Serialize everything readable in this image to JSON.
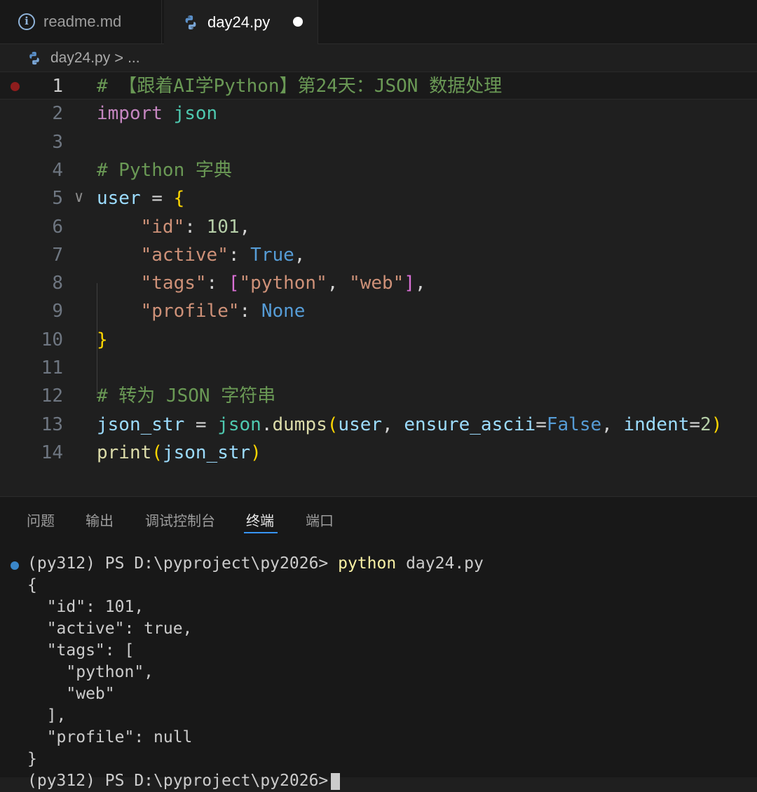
{
  "tabs": [
    {
      "label": "readme.md",
      "icon": "info-icon",
      "active": false
    },
    {
      "label": "day24.py",
      "icon": "python-icon",
      "active": true,
      "dirty": true
    }
  ],
  "breadcrumb": {
    "file": "day24.py",
    "separator": ">",
    "more": "..."
  },
  "editor": {
    "lines": [
      {
        "n": "1",
        "code": "# 【跟着AI学Python】第24天：JSON 数据处理"
      },
      {
        "n": "2",
        "code": "import json"
      },
      {
        "n": "3",
        "code": ""
      },
      {
        "n": "4",
        "code": "# Python 字典"
      },
      {
        "n": "5",
        "code": "user = {"
      },
      {
        "n": "6",
        "code": "    \"id\": 101,"
      },
      {
        "n": "7",
        "code": "    \"active\": True,"
      },
      {
        "n": "8",
        "code": "    \"tags\": [\"python\", \"web\"],"
      },
      {
        "n": "9",
        "code": "    \"profile\": None"
      },
      {
        "n": "10",
        "code": "}"
      },
      {
        "n": "11",
        "code": ""
      },
      {
        "n": "12",
        "code": "# 转为 JSON 字符串"
      },
      {
        "n": "13",
        "code": "json_str = json.dumps(user, ensure_ascii=False, indent=2)"
      },
      {
        "n": "14",
        "code": "print(json_str)"
      }
    ],
    "colors": {
      "comment": "#6a9955",
      "keyword": "#c586c0",
      "string": "#ce9178",
      "number": "#b5cea8",
      "constant": "#569cd6",
      "function": "#dcdcaa",
      "variable": "#9cdcfe",
      "bracket": "#ffd700"
    }
  },
  "panel": {
    "tabs": [
      "问题",
      "输出",
      "调试控制台",
      "终端",
      "端口"
    ],
    "active_tab": "终端",
    "terminal": {
      "prompt": "(py312) PS D:\\pyproject\\py2026>",
      "command": "python",
      "args": "day24.py",
      "output": [
        "{",
        "  \"id\": 101,",
        "  \"active\": true,",
        "  \"tags\": [",
        "    \"python\",",
        "    \"web\"",
        "  ],",
        "  \"profile\": null",
        "}"
      ],
      "next_prompt": "(py312) PS D:\\pyproject\\py2026>"
    }
  }
}
